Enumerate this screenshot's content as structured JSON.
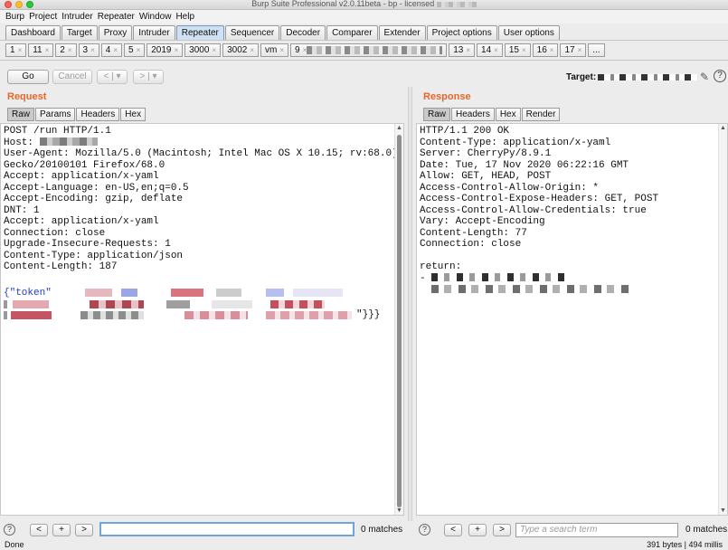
{
  "window": {
    "title": "Burp Suite Professional v2.0.11beta - bp - licensed"
  },
  "menubar": [
    "Burp",
    "Project",
    "Intruder",
    "Repeater",
    "Window",
    "Help"
  ],
  "main_tabs": [
    {
      "label": "Dashboard"
    },
    {
      "label": "Target"
    },
    {
      "label": "Proxy"
    },
    {
      "label": "Intruder"
    },
    {
      "label": "Repeater",
      "active": true
    },
    {
      "label": "Sequencer"
    },
    {
      "label": "Decoder"
    },
    {
      "label": "Comparer"
    },
    {
      "label": "Extender"
    },
    {
      "label": "Project options"
    },
    {
      "label": "User options"
    }
  ],
  "repeater_tabs": [
    "1",
    "11",
    "2",
    "3",
    "4",
    "5",
    "2019",
    "3000",
    "3002",
    "vm",
    "9",
    "13",
    "14",
    "15",
    "16",
    "17",
    "..."
  ],
  "toolbar": {
    "go": "Go",
    "cancel": "Cancel",
    "back": "<",
    "forward": ">",
    "dropdown": "▾",
    "target_label": "Target:"
  },
  "request": {
    "title": "Request",
    "tabs": [
      "Raw",
      "Params",
      "Headers",
      "Hex"
    ],
    "active_tab": "Raw",
    "lines": [
      "POST /run HTTP/1.1",
      "Host:",
      "User-Agent: Mozilla/5.0 (Macintosh; Intel Mac OS X 10.15; rv:68.0)",
      "Gecko/20100101 Firefox/68.0",
      "Accept: application/x-yaml",
      "Accept-Language: en-US,en;q=0.5",
      "Accept-Encoding: gzip, deflate",
      "DNT: 1",
      "Accept: application/x-yaml",
      "Connection: close",
      "Upgrade-Insecure-Requests: 1",
      "Content-Type: application/json",
      "Content-Length: 187"
    ],
    "body_start": "{\"token\"",
    "body_end": "\"}}}"
  },
  "response": {
    "title": "Response",
    "tabs": [
      "Raw",
      "Headers",
      "Hex",
      "Render"
    ],
    "active_tab": "Raw",
    "lines": [
      "HTTP/1.1 200 OK",
      "Content-Type: application/x-yaml",
      "Server: CherryPy/8.9.1",
      "Date: Tue, 17 Nov 2020 06:22:16 GMT",
      "Allow: GET, HEAD, POST",
      "Access-Control-Allow-Origin: *",
      "Access-Control-Expose-Headers: GET, POST",
      "Access-Control-Allow-Credentials: true",
      "Vary: Accept-Encoding",
      "Content-Length: 77",
      "Connection: close",
      "",
      "return:",
      "-"
    ]
  },
  "search": {
    "request_matches": "0 matches",
    "response_matches": "0 matches",
    "response_placeholder": "Type a search term",
    "prev": "<",
    "add": "+",
    "next": ">",
    "help": "?"
  },
  "status": {
    "left": "Done",
    "right": "391 bytes | 494 millis"
  },
  "colors": {
    "accent": "#e5662c",
    "active_tab": "#cfe1f2"
  }
}
